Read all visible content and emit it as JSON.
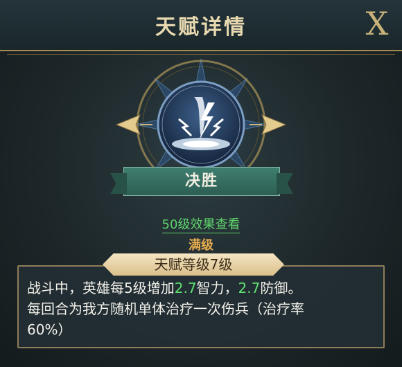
{
  "header": {
    "title": "天赋详情",
    "close_label": "X"
  },
  "talent": {
    "name": "决胜",
    "effect_link": "50级效果查看",
    "status": "满级",
    "level_label": "天赋等级7级",
    "description": {
      "line1_prefix": "战斗中，英雄每5级增加",
      "int_value": "2.7",
      "line1_mid": "智力，",
      "def_value": "2.7",
      "line1_suffix": "防御。",
      "line2": "每回合为我方随机单体治疗一次伤兵（治疗率",
      "line3": "60%）"
    }
  },
  "colors": {
    "gold": "#c8b27a",
    "banner_teal": "#3f7f70",
    "link_green": "#5fd36c",
    "status_orange": "#e9ad4e",
    "value_green": "#5fe270"
  },
  "icons": {
    "talent": "lightning-strike-emblem-icon",
    "close": "close-icon"
  }
}
